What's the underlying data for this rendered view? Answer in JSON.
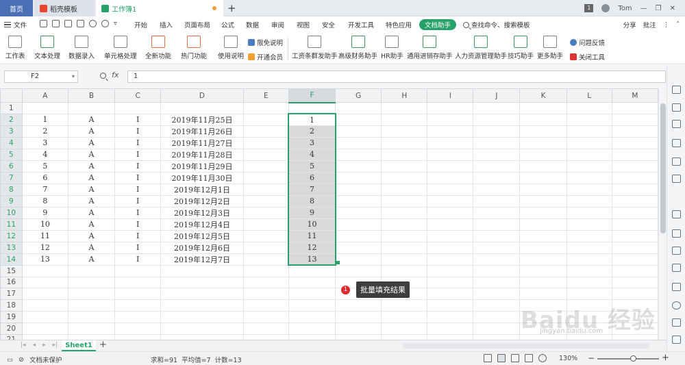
{
  "titlebar": {
    "tab_home": "首页",
    "tab_draft": "稻壳模板",
    "tab_workbook": "工作簿1",
    "badge": "1",
    "user": "Tom"
  },
  "menubar": {
    "file": "文件",
    "items": [
      "开始",
      "插入",
      "页面布局",
      "公式",
      "数据",
      "审阅",
      "视图",
      "安全",
      "开发工具",
      "特色应用",
      "文档助手"
    ],
    "search_placeholder": "查找命令、搜索模板",
    "share": "分享",
    "annotate": "批注"
  },
  "ribbon": {
    "buttons": [
      "工作表",
      "文本处理",
      "数据录入",
      "单元格处理",
      "全新功能",
      "热门功能",
      "使用说明"
    ],
    "limited": "限免说明",
    "vip": "开通会员",
    "helpers": [
      "工资条群发助手",
      "高级财务助手",
      "HR助手",
      "通用进销存助手",
      "人力资源管理助手",
      "技巧助手",
      "更多助手"
    ],
    "feedback": "问题反馈",
    "close_tool": "关闭工具"
  },
  "formula": {
    "cell_ref": "F2",
    "fx": "fx",
    "content": "1"
  },
  "columns": [
    "A",
    "B",
    "C",
    "D",
    "E",
    "F",
    "G",
    "H",
    "I",
    "J",
    "K",
    "L",
    "M"
  ],
  "rows": [
    [
      "",
      "",
      "",
      "",
      "",
      ""
    ],
    [
      "1",
      "A",
      "I",
      "2019年11月25日",
      "",
      "1"
    ],
    [
      "2",
      "A",
      "I",
      "2019年11月26日",
      "",
      "2"
    ],
    [
      "3",
      "A",
      "I",
      "2019年11月27日",
      "",
      "3"
    ],
    [
      "4",
      "A",
      "I",
      "2019年11月28日",
      "",
      "4"
    ],
    [
      "5",
      "A",
      "I",
      "2019年11月29日",
      "",
      "5"
    ],
    [
      "6",
      "A",
      "I",
      "2019年11月30日",
      "",
      "6"
    ],
    [
      "7",
      "A",
      "I",
      "2019年12月1日",
      "",
      "7"
    ],
    [
      "8",
      "A",
      "I",
      "2019年12月2日",
      "",
      "8"
    ],
    [
      "9",
      "A",
      "I",
      "2019年12月3日",
      "",
      "9"
    ],
    [
      "10",
      "A",
      "I",
      "2019年12月4日",
      "",
      "10"
    ],
    [
      "11",
      "A",
      "I",
      "2019年12月5日",
      "",
      "11"
    ],
    [
      "12",
      "A",
      "I",
      "2019年12月6日",
      "",
      "12"
    ],
    [
      "13",
      "A",
      "I",
      "2019年12月7日",
      "",
      "13"
    ],
    [
      "",
      "",
      "",
      "",
      "",
      ""
    ],
    [
      "",
      "",
      "",
      "",
      "",
      ""
    ],
    [
      "",
      "",
      "",
      "",
      "",
      ""
    ],
    [
      "",
      "",
      "",
      "",
      "",
      ""
    ],
    [
      "",
      "",
      "",
      "",
      "",
      ""
    ],
    [
      "",
      "",
      "",
      "",
      "",
      ""
    ],
    [
      "",
      "",
      "",
      "",
      "",
      ""
    ]
  ],
  "callout": {
    "number": "1",
    "label": "批量填充结果"
  },
  "sheet_tab": "Sheet1",
  "status": {
    "protect": "文档未保护",
    "sum": "求和=91",
    "avg": "平均值=7",
    "count": "计数=13",
    "zoom": "130%"
  },
  "watermark": "Baidu 经验",
  "watermark_url": "jingyan.baidu.com",
  "colors": {
    "accent": "#26a269",
    "home_tab": "#4a6fb5",
    "callout_red": "#e02a2a"
  }
}
